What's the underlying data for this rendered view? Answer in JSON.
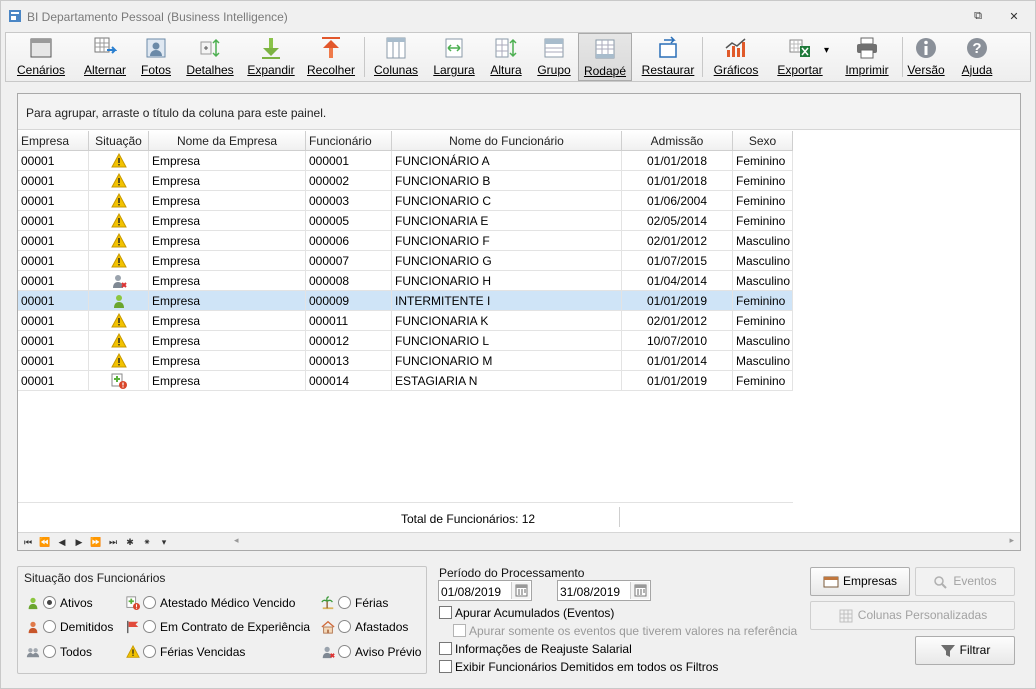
{
  "window": {
    "title": "BI Departamento Pessoal  (Business Intelligence)",
    "restore_glyph": "⧉",
    "close_glyph": "✕"
  },
  "toolbar": {
    "items": [
      {
        "label": "Cenários",
        "icon": "window-icon"
      },
      {
        "label": "Alternar",
        "icon": "grid-arrow-icon"
      },
      {
        "label": "Fotos",
        "icon": "photo-icon"
      },
      {
        "label": "Detalhes",
        "icon": "details-icon"
      },
      {
        "label": "Expandir",
        "icon": "arrow-down-icon"
      },
      {
        "label": "Recolher",
        "icon": "arrow-up-icon"
      },
      {
        "label": "Colunas",
        "icon": "columns-icon"
      },
      {
        "label": "Largura",
        "icon": "width-icon"
      },
      {
        "label": "Altura",
        "icon": "height-icon"
      },
      {
        "label": "Grupo",
        "icon": "group-icon"
      },
      {
        "label": "Rodapé",
        "icon": "footer-icon"
      },
      {
        "label": "Restaurar",
        "icon": "restore-icon"
      },
      {
        "label": "Gráficos",
        "icon": "chart-icon"
      },
      {
        "label": "Exportar",
        "icon": "excel-icon"
      },
      {
        "label": "Imprimir",
        "icon": "printer-icon"
      },
      {
        "label": "Versão",
        "icon": "info-icon"
      },
      {
        "label": "Ajuda",
        "icon": "help-icon"
      }
    ],
    "export_dropdown_glyph": "▾"
  },
  "grid": {
    "group_hint": "Para agrupar, arraste o título da coluna para este painel.",
    "columns": [
      "Empresa",
      "Situação",
      "Nome da Empresa",
      "Funcionário",
      "Nome do Funcionário",
      "Admissão",
      "Sexo"
    ],
    "rows": [
      {
        "empresa": "00001",
        "status_icon": "warning-icon",
        "nome_empresa": "Empresa",
        "funcionario": "000001",
        "nome": "FUNCIONÁRIO A",
        "admissao": "01/01/2018",
        "sexo": "Feminino"
      },
      {
        "empresa": "00001",
        "status_icon": "warning-icon",
        "nome_empresa": "Empresa",
        "funcionario": "000002",
        "nome": "FUNCIONARIO B",
        "admissao": "01/01/2018",
        "sexo": "Feminino"
      },
      {
        "empresa": "00001",
        "status_icon": "warning-icon",
        "nome_empresa": "Empresa",
        "funcionario": "000003",
        "nome": "FUNCIONARIO C",
        "admissao": "01/06/2004",
        "sexo": "Feminino"
      },
      {
        "empresa": "00001",
        "status_icon": "warning-icon",
        "nome_empresa": "Empresa",
        "funcionario": "000005",
        "nome": "FUNCIONARIA E",
        "admissao": "02/05/2014",
        "sexo": "Feminino"
      },
      {
        "empresa": "00001",
        "status_icon": "warning-icon",
        "nome_empresa": "Empresa",
        "funcionario": "000006",
        "nome": "FUNCIONARIO F",
        "admissao": "02/01/2012",
        "sexo": "Masculino"
      },
      {
        "empresa": "00001",
        "status_icon": "warning-icon",
        "nome_empresa": "Empresa",
        "funcionario": "000007",
        "nome": "FUNCIONARIO G",
        "admissao": "01/07/2015",
        "sexo": "Masculino"
      },
      {
        "empresa": "00001",
        "status_icon": "notice-person-icon",
        "nome_empresa": "Empresa",
        "funcionario": "000008",
        "nome": "FUNCIONARIO H",
        "admissao": "01/04/2014",
        "sexo": "Masculino"
      },
      {
        "empresa": "00001",
        "status_icon": "active-person-icon",
        "nome_empresa": "Empresa",
        "funcionario": "000009",
        "nome": "INTERMITENTE I",
        "admissao": "01/01/2019",
        "sexo": "Feminino",
        "selected": true
      },
      {
        "empresa": "00001",
        "status_icon": "warning-icon",
        "nome_empresa": "Empresa",
        "funcionario": "000011",
        "nome": "FUNCIONARIA K",
        "admissao": "02/01/2012",
        "sexo": "Feminino"
      },
      {
        "empresa": "00001",
        "status_icon": "warning-icon",
        "nome_empresa": "Empresa",
        "funcionario": "000012",
        "nome": "FUNCIONARIO L",
        "admissao": "10/07/2010",
        "sexo": "Masculino"
      },
      {
        "empresa": "00001",
        "status_icon": "warning-icon",
        "nome_empresa": "Empresa",
        "funcionario": "000013",
        "nome": "FUNCIONARIO M",
        "admissao": "01/01/2014",
        "sexo": "Masculino"
      },
      {
        "empresa": "00001",
        "status_icon": "expired-certificate-icon",
        "nome_empresa": "Empresa",
        "funcionario": "000014",
        "nome": "ESTAGIARIA N",
        "admissao": "01/01/2019",
        "sexo": "Feminino"
      }
    ],
    "footer_total": "Total de Funcionários: 12",
    "nav_buttons": [
      "⏮",
      "⏪",
      "◀",
      "▶",
      "⏩",
      "⏭",
      "✱",
      "⁕",
      "▾"
    ],
    "hscroll_left": "◂",
    "hscroll_right": "▸"
  },
  "situacao": {
    "legend": "Situação dos Funcionários",
    "options": [
      {
        "label": "Ativos",
        "icon": "active-person-icon",
        "checked": true
      },
      {
        "label": "Demitidos",
        "icon": "dismissed-person-icon",
        "checked": false
      },
      {
        "label": "Todos",
        "icon": "people-icon",
        "checked": false
      },
      {
        "label": "Atestado Médico Vencido",
        "icon": "expired-certificate-icon",
        "checked": false
      },
      {
        "label": "Em Contrato de Experiência",
        "icon": "flag-icon",
        "checked": false
      },
      {
        "label": "Férias Vencidas",
        "icon": "warning-icon",
        "checked": false
      },
      {
        "label": "Férias",
        "icon": "beach-icon",
        "checked": false
      },
      {
        "label": "Afastados",
        "icon": "home-icon",
        "checked": false
      },
      {
        "label": "Aviso Prévio",
        "icon": "notice-person-icon",
        "checked": false
      }
    ]
  },
  "periodo": {
    "label": "Período do Processamento",
    "start": "01/08/2019",
    "end": "31/08/2019"
  },
  "options": {
    "apurar": "Apurar Acumulados (Eventos)",
    "apurar_sub": "Apurar somente os eventos que tiverem valores na referência",
    "reajuste": "Informações de Reajuste Salarial",
    "demitidos": "Exibir Funcionários Demitidos em todos os Filtros"
  },
  "buttons": {
    "empresas": "Empresas",
    "eventos": "Eventos",
    "colunas": "Colunas Personalizadas",
    "filtrar": "Filtrar"
  },
  "colors": {
    "selection": "#cfe4f7",
    "warning": "#f0c000",
    "accent_green": "#7bb13a",
    "accent_red": "#d04a2c"
  }
}
